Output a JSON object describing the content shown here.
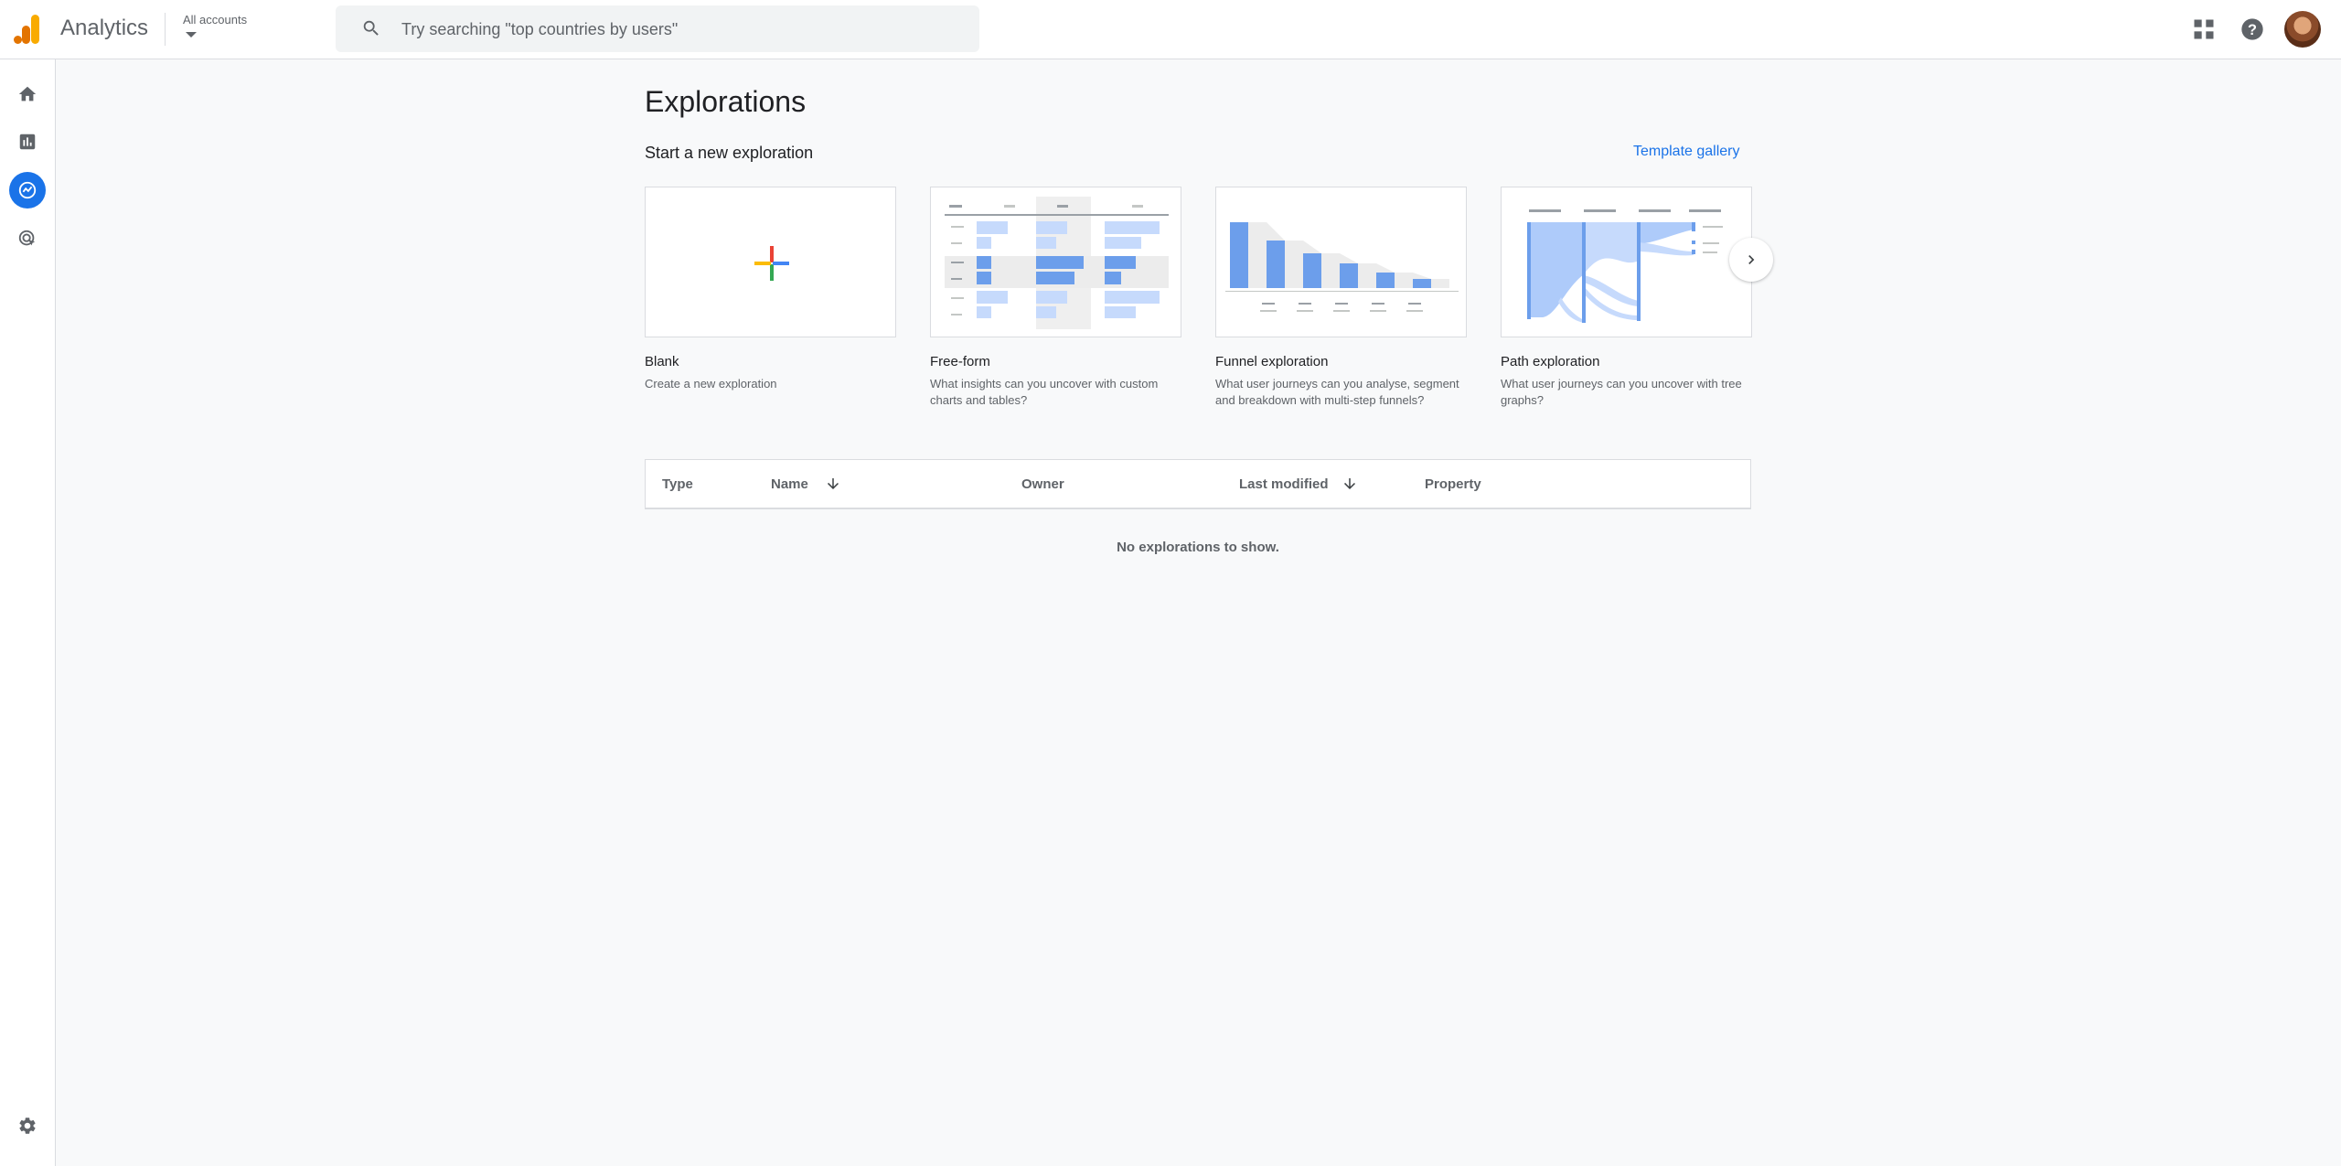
{
  "header": {
    "app_title": "Analytics",
    "account_label": "All accounts",
    "search_placeholder": "Try searching \"top countries by users\""
  },
  "icons": {
    "logo": "analytics-logo-icon",
    "search": "search-icon",
    "apps": "apps-grid-icon",
    "help": "help-icon",
    "nav": [
      "home-icon",
      "reports-icon",
      "explore-icon",
      "advertising-icon",
      "settings-icon"
    ]
  },
  "colors": {
    "accent": "#1a73e8",
    "logo_orange": "#f9ab00",
    "logo_dark_orange": "#e37400",
    "background": "#f8f9fa"
  },
  "main": {
    "title": "Explorations",
    "start_label": "Start a new exploration",
    "template_gallery": "Template gallery",
    "templates": [
      {
        "name": "Blank",
        "description": "Create a new exploration"
      },
      {
        "name": "Free-form",
        "description": "What insights can you uncover with custom charts and tables?"
      },
      {
        "name": "Funnel exploration",
        "description": "What user journeys can you analyse, segment and breakdown with multi-step funnels?"
      },
      {
        "name": "Path exploration",
        "description": "What user journeys can you uncover with tree graphs?"
      }
    ],
    "table": {
      "columns": [
        "Type",
        "Name",
        "Owner",
        "Last modified",
        "Property"
      ],
      "empty_message": "No explorations to show."
    }
  }
}
